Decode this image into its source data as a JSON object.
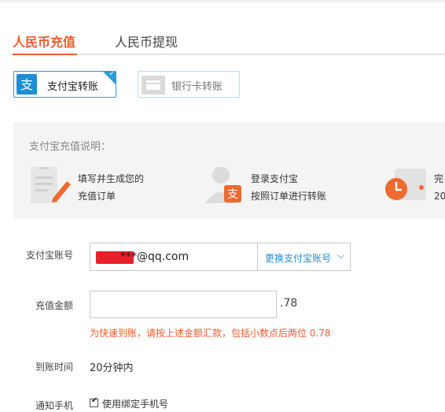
{
  "tabs": [
    {
      "label": "人民币充值",
      "active": true
    },
    {
      "label": "人民币提现",
      "active": false
    }
  ],
  "methods": {
    "alipay": {
      "label": "支付宝转账",
      "selected": true,
      "icon": "alipay-icon"
    },
    "bank": {
      "label": "银行卡转账",
      "selected": false,
      "icon": "bank-card-icon"
    }
  },
  "info": {
    "title": "支付宝充值说明：",
    "steps": [
      {
        "line1": "填写并生成您的",
        "line2": "充值订单",
        "icon": "form-edit-icon"
      },
      {
        "line1": "登录支付宝",
        "line2": "按照订单进行转账",
        "icon": "user-alipay-icon"
      },
      {
        "line1": "完",
        "line2": "20",
        "icon": "clock-icon"
      }
    ]
  },
  "form": {
    "account": {
      "label": "支付宝账号",
      "value": "***@qq.com",
      "change_label": "更换支付宝账号"
    },
    "amount": {
      "label": "充值金额",
      "value": "",
      "suffix": ".78",
      "hint": "为快速到账，请按上述金额汇款，包括小数点后两位 0.78"
    },
    "arrival": {
      "label": "到账时间",
      "value": "20分钟内"
    },
    "notify": {
      "label": "通知手机",
      "checkbox_label": "使用绑定手机号",
      "checked": true
    }
  },
  "colors": {
    "accent": "#ee5c2e",
    "alipay_blue": "#1f8dd6"
  }
}
